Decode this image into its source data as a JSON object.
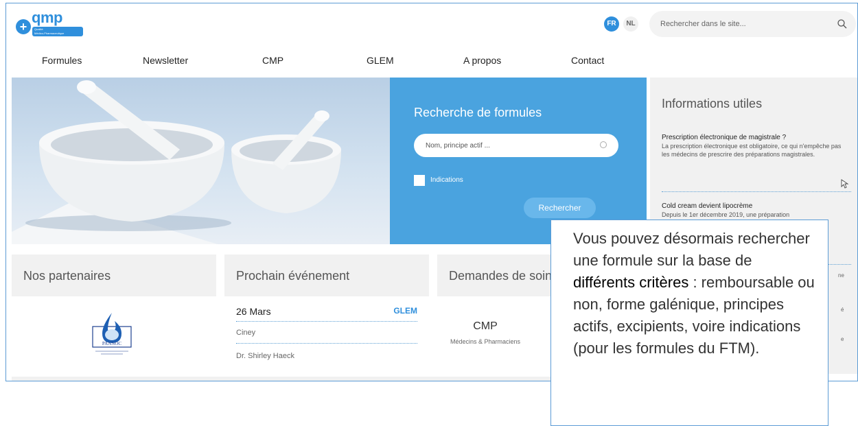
{
  "header": {
    "logo": {
      "word": "qmp",
      "tagline_1": "Qualité",
      "tagline_2": "Médico-Pharmaceutique"
    },
    "lang": {
      "fr": "FR",
      "nl": "NL"
    },
    "search": {
      "placeholder": "Rechercher dans le site..."
    }
  },
  "nav": {
    "items": [
      {
        "label": "Formules"
      },
      {
        "label": "Newsletter"
      },
      {
        "label": "CMP"
      },
      {
        "label": "GLEM"
      },
      {
        "label": "A propos"
      },
      {
        "label": "Contact"
      }
    ]
  },
  "formula_search": {
    "title": "Recherche de formules",
    "placeholder": "Nom, principe actif ...",
    "checkbox_label": "Indications",
    "button": "Rechercher"
  },
  "info": {
    "title": "Informations utiles",
    "items": [
      {
        "title": "Prescription électronique de magistrale ?",
        "text": "La prescription électronique est obligatoire, ce qui n'empêche pas les médecins de prescrire des préparations magistrales."
      },
      {
        "title": "Cold cream devient lipocrème",
        "text": "Depuis le 1er décembre 2019, une préparation"
      }
    ],
    "clipped": [
      "ne",
      "é",
      "e"
    ]
  },
  "cards": {
    "partners": {
      "title": "Nos partenaires",
      "logo_text": "PANNOC"
    },
    "event": {
      "title": "Prochain événement",
      "date": "26 Mars",
      "tag": "GLEM",
      "place": "Ciney",
      "person": "Dr. Shirley Haeck"
    },
    "requests": {
      "title": "Demandes de soins",
      "cmp_title": "CMP",
      "cmp_sub": "Médecins & Pharmaciens"
    }
  },
  "callout": {
    "text_before": "Vous pouvez désormais rechercher une formule sur la base de ",
    "highlight": "différents critères",
    "text_after": " : remboursable ou non, forme galénique, principes actifs, excipients, voire indications (pour les formules du FTM)."
  },
  "colors": {
    "brand_blue": "#2f8fdc",
    "search_panel": "#4aa3df",
    "frame_border": "#5b9bd5"
  }
}
